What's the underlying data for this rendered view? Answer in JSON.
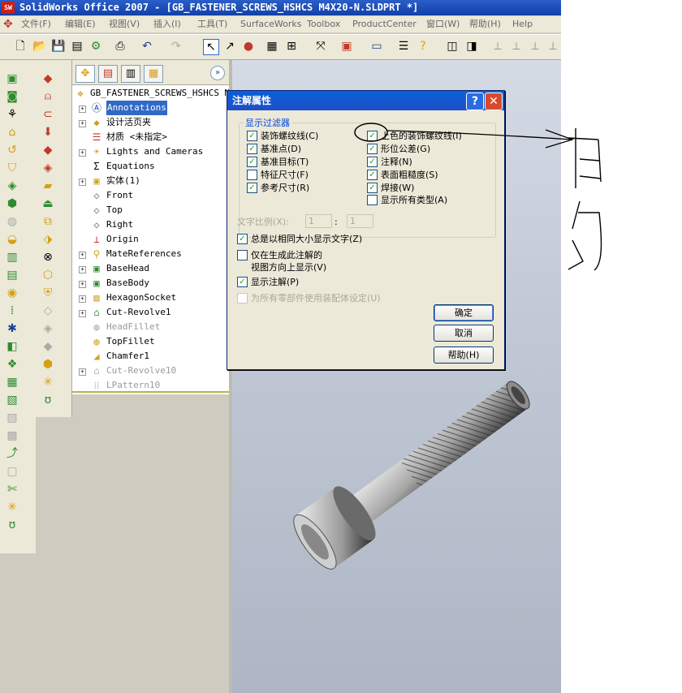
{
  "window": {
    "title": "SolidWorks Office 2007 - [GB_FASTENER_SCREWS_HSHCS M4X20-N.SLDPRT *]",
    "logo_text": "SW"
  },
  "menu": [
    "文件(F)",
    "编辑(E)",
    "视图(V)",
    "插入(I)",
    "工具(T)",
    "SurfaceWorks",
    "Toolbox",
    "ProductCenter",
    "窗口(W)",
    "帮助(H)",
    "Help"
  ],
  "feature_manager": {
    "tree": [
      {
        "label": "GB_FASTENER_SCREWS_HSHCS M4X",
        "icon": "part-icon",
        "expand": ""
      },
      {
        "label": "Annotations",
        "icon": "annotations-icon",
        "expand": "+",
        "highlight": true
      },
      {
        "label": "设计活页夹",
        "icon": "design-binder-icon",
        "expand": "+"
      },
      {
        "label": "材质 <未指定>",
        "icon": "material-icon",
        "expand": ""
      },
      {
        "label": "Lights and Cameras",
        "icon": "lights-icon",
        "expand": "+"
      },
      {
        "label": "Equations",
        "icon": "equations-icon",
        "expand": ""
      },
      {
        "label": "实体(1)",
        "icon": "solid-bodies-icon",
        "expand": "+"
      },
      {
        "label": "Front",
        "icon": "plane-icon",
        "expand": ""
      },
      {
        "label": "Top",
        "icon": "plane-icon",
        "expand": ""
      },
      {
        "label": "Right",
        "icon": "plane-icon",
        "expand": ""
      },
      {
        "label": "Origin",
        "icon": "origin-icon",
        "expand": ""
      },
      {
        "label": "MateReferences",
        "icon": "mate-reference-icon",
        "expand": "+"
      },
      {
        "label": "BaseHead",
        "icon": "extrude-icon",
        "expand": "+"
      },
      {
        "label": "BaseBody",
        "icon": "extrude-icon",
        "expand": "+"
      },
      {
        "label": "HexagonSocket",
        "icon": "cut-extrude-icon",
        "expand": "+"
      },
      {
        "label": "Cut-Revolve1",
        "icon": "cut-revolve-icon",
        "expand": "+"
      },
      {
        "label": "HeadFillet",
        "icon": "fillet-icon",
        "expand": "",
        "dim": true
      },
      {
        "label": "TopFillet",
        "icon": "fillet-icon",
        "expand": ""
      },
      {
        "label": "Chamfer1",
        "icon": "chamfer-icon",
        "expand": ""
      },
      {
        "label": "Cut-Revolve10",
        "icon": "cut-revolve-icon",
        "expand": "+",
        "dim": true
      },
      {
        "label": "LPattern10",
        "icon": "linear-pattern-icon",
        "expand": "",
        "dim": true
      }
    ]
  },
  "dialog": {
    "title": "注解属性",
    "group_label": "显示过滤器",
    "filters_left": [
      {
        "label": "装饰螺纹线(C)",
        "checked": true
      },
      {
        "label": "基准点(D)",
        "checked": true
      },
      {
        "label": "基准目标(T)",
        "checked": true
      },
      {
        "label": "特征尺寸(F)",
        "checked": false
      },
      {
        "label": "参考尺寸(R)",
        "checked": true
      }
    ],
    "filters_right": [
      {
        "label": "上色的装饰螺纹线(I)",
        "checked": true
      },
      {
        "label": "形位公差(G)",
        "checked": true
      },
      {
        "label": "注释(N)",
        "checked": true
      },
      {
        "label": "表面粗糙度(S)",
        "checked": true
      },
      {
        "label": "焊接(W)",
        "checked": true
      },
      {
        "label": "显示所有类型(A)",
        "checked": false
      }
    ],
    "text_scale_label": "文字比例(X):",
    "text_scale_a": "1",
    "text_scale_sep": ":",
    "text_scale_b": "1",
    "always_same_size": "总是以相同大小显示文字(Z)",
    "only_in_view_line1": "仅在生成此注解的",
    "only_in_view_line2": "视图方向上显示(V)",
    "display_annotations": "显示注解(P)",
    "use_assembly": "为所有零部件使用装配体设定(U)",
    "ok": "确定",
    "cancel": "取消",
    "help": "帮助(H)"
  },
  "colors": {
    "title_blue": "#1f4fc6",
    "check_green": "#21a121",
    "highlight": "#316ac5"
  }
}
